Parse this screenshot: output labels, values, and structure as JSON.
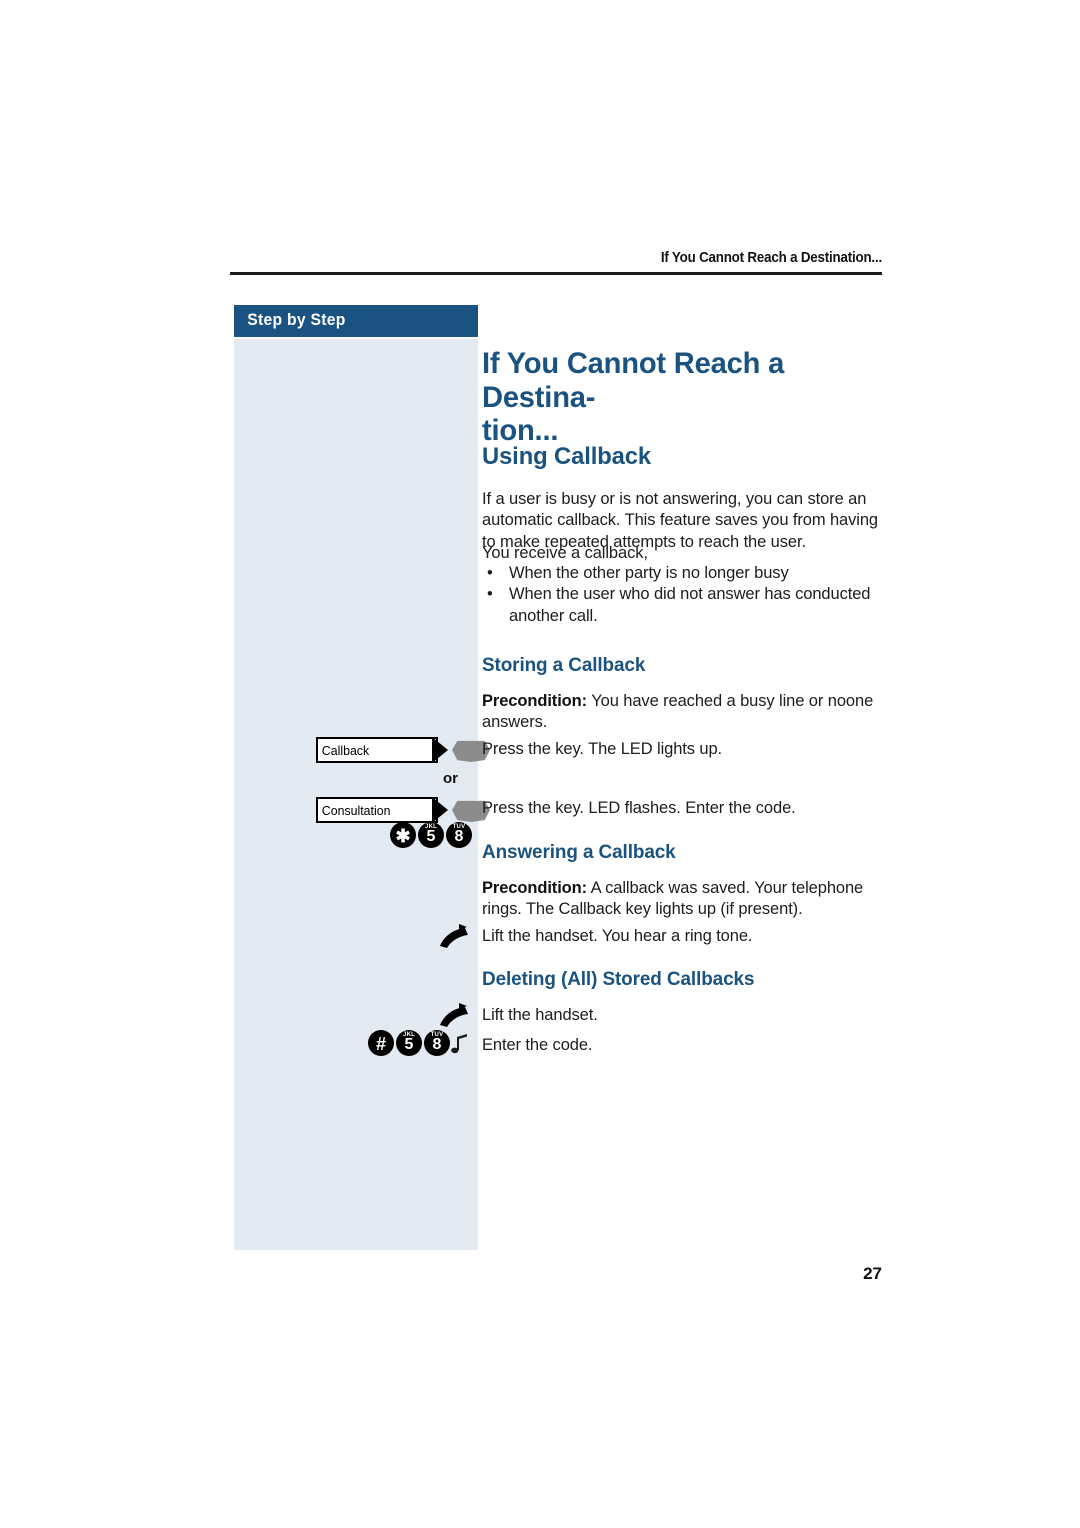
{
  "header": {
    "running_head": "If You Cannot Reach a Destination..."
  },
  "sidebar": {
    "title": "Step by Step",
    "keys": [
      {
        "label": "Callback",
        "icon": "function-key-icon"
      },
      {
        "label": "Consultation",
        "icon": "function-key-icon"
      }
    ],
    "or_label": "or",
    "keypad_codes": [
      {
        "id": "code-star-5-8",
        "keys": [
          {
            "digit": "✱",
            "letters": ""
          },
          {
            "digit": "5",
            "letters": "JKL"
          },
          {
            "digit": "8",
            "letters": "TUV"
          }
        ],
        "trailing_icon": null
      },
      {
        "id": "code-hash-5-8",
        "keys": [
          {
            "digit": "#",
            "letters": ""
          },
          {
            "digit": "5",
            "letters": "JKL"
          },
          {
            "digit": "8",
            "letters": "TUV"
          }
        ],
        "trailing_icon": "tone-note-icon"
      }
    ],
    "handset_icons": [
      "lift-handset-icon",
      "lift-handset-icon"
    ]
  },
  "main": {
    "title": "If You Cannot Reach a Destina-­tion...",
    "title_line1": "If You Cannot Reach a Destina-",
    "title_line2": "tion...",
    "section_heading": "Using Callback",
    "intro": "If a user is busy or is not answering, you can store an automatic callback. This feature saves you from having to make repeated attempts to reach the user.",
    "intro_lead_in": "You receive a callback,",
    "bullet_char": "•",
    "bullets": [
      "When the other party is no longer busy",
      "When the user who did not answer has conducted another call."
    ],
    "subsections": [
      {
        "heading": "Storing a Callback",
        "precondition_label": "Precondition:",
        "precondition_text": " You have reached a busy line or noone answers.",
        "steps": [
          "Press the key. The LED lights up.",
          "Press the key. LED flashes. Enter the code."
        ]
      },
      {
        "heading": "Answering a Callback",
        "precondition_label": "Precondition:",
        "precondition_text": " A callback was saved. Your telephone rings. The Callback key lights up (if present).",
        "steps": [
          "Lift the handset. You hear a ring tone."
        ]
      },
      {
        "heading": "Deleting (All) Stored Callbacks",
        "steps": [
          "Lift the handset.",
          "Enter the code."
        ]
      }
    ]
  },
  "footer": {
    "page_number": "27"
  },
  "colors": {
    "brand_blue": "#1a5381",
    "panel_blue": "#e4eaf1",
    "text": "#1d1d1d",
    "key_grey": "#8c8c8c"
  }
}
